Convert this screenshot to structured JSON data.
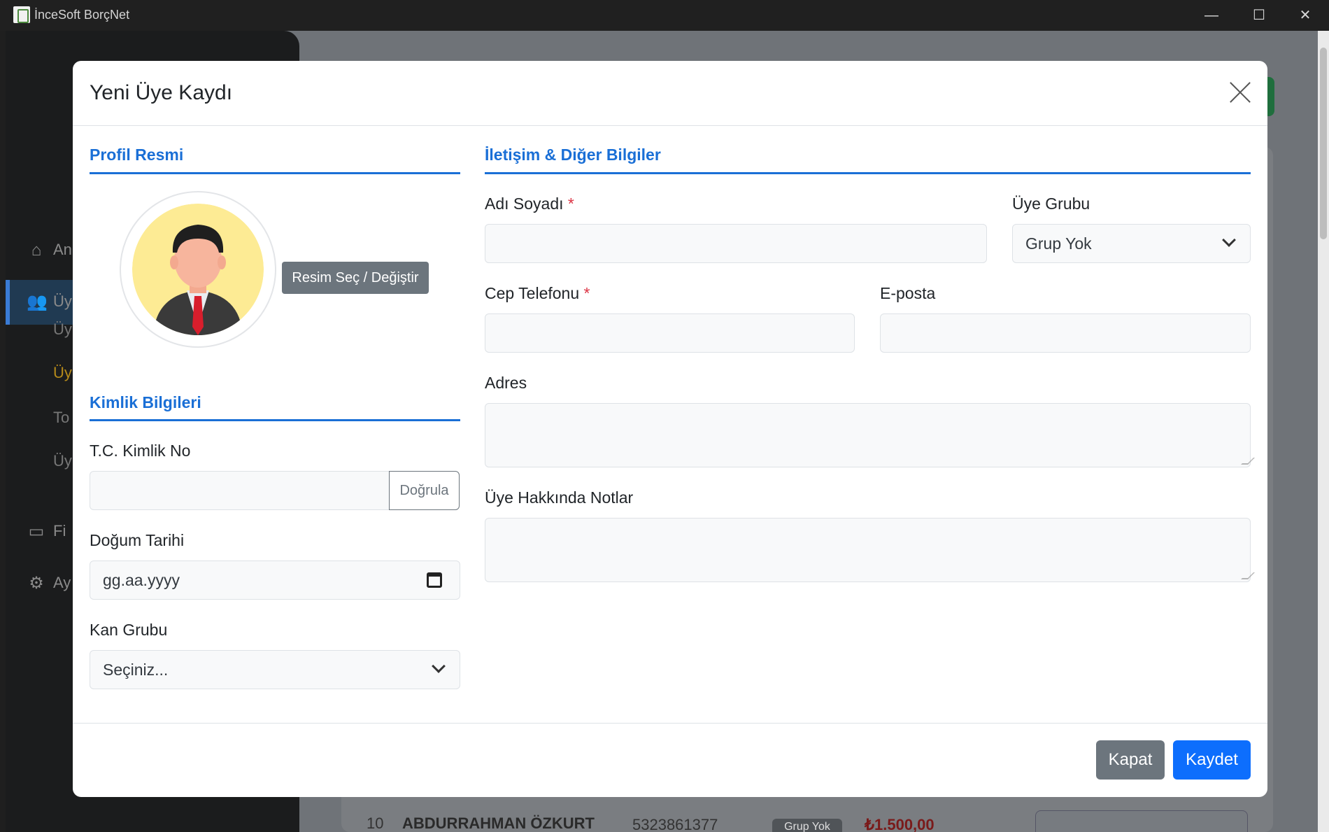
{
  "window": {
    "title": "İnceSoft BorçNet",
    "minimize_glyph": "—",
    "maximize_glyph": "☐",
    "close_glyph": "✕"
  },
  "background": {
    "sidebar": {
      "items": [
        {
          "icon": "home-icon",
          "label": "An"
        },
        {
          "icon": "users-icon",
          "label": "Üy"
        },
        {
          "icon": "wallet-icon",
          "label": "Fi"
        },
        {
          "icon": "gear-icon",
          "label": "Ay"
        }
      ],
      "subitems": [
        "Üy",
        "Üy",
        "To",
        "Üy"
      ]
    },
    "row": {
      "index": "10",
      "name": "ABDURRAHMAN ÖZKURT",
      "phone": "5323861377",
      "group": "Grup Yok",
      "amount": "₺1.500,00"
    }
  },
  "modal": {
    "title": "Yeni Üye Kaydı",
    "profile": {
      "section_title": "Profil Resmi",
      "pick_button": "Resim Seç / Değiştir"
    },
    "identity": {
      "section_title": "Kimlik Bilgileri",
      "tc_label": "T.C. Kimlik No",
      "tc_value": "",
      "verify_button": "Doğrula",
      "birth_label": "Doğum Tarihi",
      "birth_placeholder": "gg.aa.yyyy",
      "blood_label": "Kan Grubu",
      "blood_selected": "Seçiniz..."
    },
    "contact": {
      "section_title": "İletişim & Diğer Bilgiler",
      "name_label": "Adı Soyadı",
      "name_value": "",
      "group_label": "Üye Grubu",
      "group_selected": "Grup Yok",
      "phone_label": "Cep Telefonu",
      "phone_value": "",
      "email_label": "E-posta",
      "email_value": "",
      "address_label": "Adres",
      "address_value": "",
      "notes_label": "Üye Hakkında Notlar",
      "notes_value": "",
      "required_mark": "*"
    },
    "footer": {
      "close_button": "Kapat",
      "save_button": "Kaydet"
    }
  },
  "colors": {
    "accent": "#1a6fd6",
    "primary_button": "#0d6efd",
    "secondary_button": "#6c757d",
    "required": "#dc3545"
  }
}
